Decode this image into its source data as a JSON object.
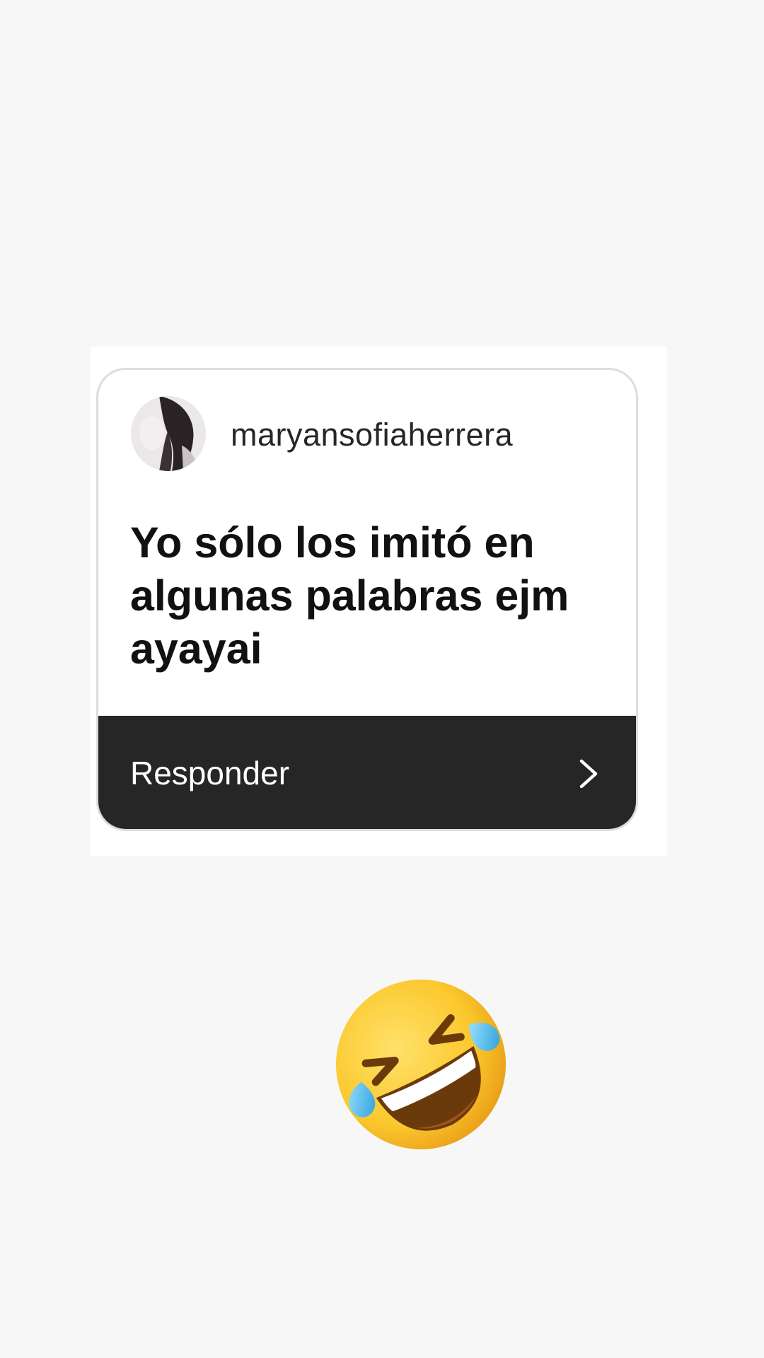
{
  "question_sticker": {
    "username": "maryansofiaherrera",
    "question_lines": [
      "Yo sólo los imitó en",
      "algunas palabras ejm",
      "ayayai"
    ],
    "reply_label": "Responder",
    "chevron_icon": "chevron-right-icon"
  },
  "sticker_emoji": {
    "icon": "rolling-on-the-floor-laughing-emoji"
  },
  "colors": {
    "background": "#f7f7f7",
    "card": "#ffffff",
    "reply_bar": "#262626",
    "text_dark": "#111111"
  }
}
